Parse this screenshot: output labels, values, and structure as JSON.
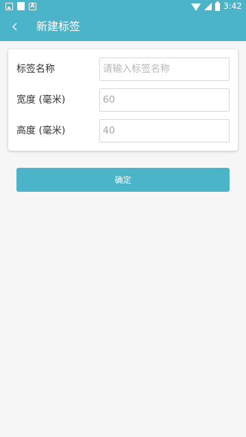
{
  "status_bar": {
    "time": "3:42",
    "left_icons": [
      "image-icon",
      "sd-card-icon",
      "a-icon"
    ],
    "right_icons": [
      "wifi-icon",
      "signal-icon",
      "battery-icon"
    ]
  },
  "toolbar": {
    "title": "新建标签",
    "back_icon": "chevron-left-icon"
  },
  "form": {
    "name": {
      "label": "标签名称",
      "value": "",
      "placeholder": "请输入标签名称"
    },
    "width": {
      "label": "宽度 (毫米)",
      "value": "60",
      "placeholder": ""
    },
    "height": {
      "label": "高度 (毫米)",
      "value": "40",
      "placeholder": ""
    }
  },
  "confirm_button": {
    "label": "确定"
  },
  "colors": {
    "accent": "#4bb4c9",
    "background": "#f6f6f6",
    "card": "#ffffff",
    "label_text": "#333333",
    "input_text": "#a7a7a7"
  }
}
